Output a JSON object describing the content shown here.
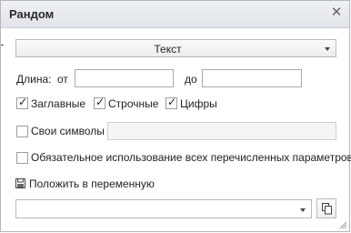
{
  "window": {
    "title": "Рандом",
    "close_icon": "close-icon"
  },
  "type_select": {
    "value": "Текст"
  },
  "length": {
    "label": "Длина:",
    "from_label": "от",
    "from_value": "",
    "to_label": "до",
    "to_value": ""
  },
  "options": {
    "uppercase": {
      "label": "Заглавные",
      "checked": true
    },
    "lowercase": {
      "label": "Строчные",
      "checked": true
    },
    "digits": {
      "label": "Цифры",
      "checked": true
    }
  },
  "custom_symbols": {
    "label": "Свои символы",
    "checked": false,
    "value": ""
  },
  "require_all": {
    "label": "Обязательное использование всех перечисленных параметров",
    "checked": false
  },
  "save_to_variable": {
    "icon": "save-icon",
    "label": "Положить в переменную",
    "value": ""
  },
  "colors": {
    "titlebar": "#e4e8ec",
    "border": "#b5b5b5"
  }
}
